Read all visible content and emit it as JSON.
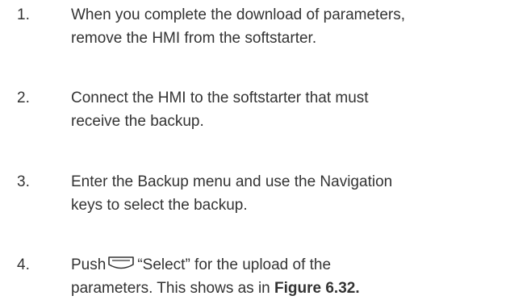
{
  "steps": [
    {
      "number": "1.",
      "line1": "When you complete the download of parameters,",
      "line2": "remove the HMI from the softstarter."
    },
    {
      "number": "2.",
      "line1": "Connect the HMI to the softstarter that must",
      "line2": "receive the backup."
    },
    {
      "number": "3.",
      "line1": "Enter the Backup menu and use the Navigation",
      "line2": "keys to select the backup."
    },
    {
      "number": "4.",
      "line1_before_icon": "Push",
      "line1_after_icon": "“Select” for the upload of the",
      "line2_plain": "parameters. This shows as in",
      "line2_bold": "Figure 6.32.",
      "icon": "soft-key-icon"
    }
  ]
}
